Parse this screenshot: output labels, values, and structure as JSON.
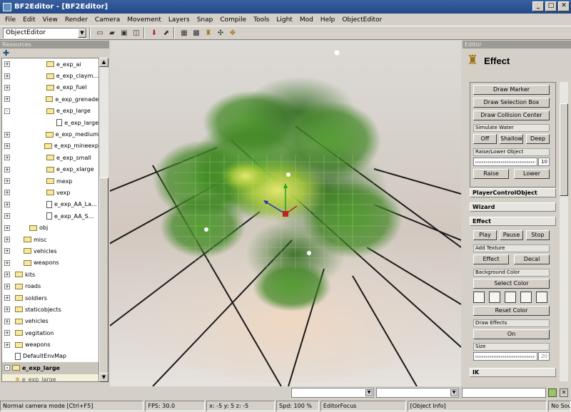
{
  "window": {
    "title": "BF2Editor - [BF2Editor]"
  },
  "menu": [
    "File",
    "Edit",
    "View",
    "Render",
    "Camera",
    "Movement",
    "Layers",
    "Snap",
    "Compile",
    "Tools",
    "Light",
    "Mod",
    "Help",
    "ObjectEditor"
  ],
  "toolbar": {
    "mode_combo": "ObjectEditor"
  },
  "resources": {
    "header": "Resources",
    "tree": [
      {
        "label": "e_exp_ai",
        "type": "folder",
        "indent": 62,
        "pm": "+"
      },
      {
        "label": "e_exp_claym...",
        "type": "folder",
        "indent": 62,
        "pm": "+"
      },
      {
        "label": "e_exp_fuel",
        "type": "folder",
        "indent": 62,
        "pm": "+"
      },
      {
        "label": "e_exp_grenade",
        "type": "folder",
        "indent": 62,
        "pm": "+"
      },
      {
        "label": "e_exp_large",
        "type": "folder",
        "indent": 62,
        "pm": "-"
      },
      {
        "label": "e_exp_large",
        "type": "file",
        "indent": 78,
        "pm": ""
      },
      {
        "label": "e_exp_medium",
        "type": "folder",
        "indent": 62,
        "pm": "+"
      },
      {
        "label": "e_exp_mineexp",
        "type": "folder",
        "indent": 62,
        "pm": "+"
      },
      {
        "label": "e_exp_small",
        "type": "folder",
        "indent": 62,
        "pm": "+"
      },
      {
        "label": "e_exp_xlarge",
        "type": "folder",
        "indent": 62,
        "pm": "+"
      },
      {
        "label": "mexp",
        "type": "folder",
        "indent": 62,
        "pm": "+"
      },
      {
        "label": "vexp",
        "type": "folder",
        "indent": 62,
        "pm": "+"
      },
      {
        "label": "e_exp_AA_La...",
        "type": "file",
        "indent": 62,
        "pm": "+"
      },
      {
        "label": "e_exp_AA_S...",
        "type": "file",
        "indent": 62,
        "pm": "+"
      },
      {
        "label": "obj",
        "type": "folder",
        "indent": 38,
        "pm": "+"
      },
      {
        "label": "misc",
        "type": "folder",
        "indent": 30,
        "pm": "+"
      },
      {
        "label": "vehicles",
        "type": "folder",
        "indent": 30,
        "pm": "+"
      },
      {
        "label": "weapons",
        "type": "folder",
        "indent": 30,
        "pm": "+"
      },
      {
        "label": "kits",
        "type": "folder",
        "indent": 18,
        "pm": "+"
      },
      {
        "label": "roads",
        "type": "folder",
        "indent": 18,
        "pm": "+"
      },
      {
        "label": "soldiers",
        "type": "folder",
        "indent": 18,
        "pm": "+"
      },
      {
        "label": "staticobjects",
        "type": "folder",
        "indent": 18,
        "pm": "+"
      },
      {
        "label": "vehicles",
        "type": "folder",
        "indent": 18,
        "pm": "+"
      },
      {
        "label": "vegitation",
        "type": "folder",
        "indent": 18,
        "pm": "+"
      },
      {
        "label": "weapons",
        "type": "folder",
        "indent": 18,
        "pm": "+"
      },
      {
        "label": "DefaultEnvMap",
        "type": "file",
        "indent": 18,
        "pm": ""
      },
      {
        "label": "e_exp_large",
        "type": "folder",
        "indent": 14,
        "pm": "-",
        "state": "selected-parent"
      },
      {
        "label": "e_exp_large",
        "type": "effect",
        "indent": 18,
        "pm": "",
        "state": "selected-child"
      }
    ]
  },
  "editor": {
    "header": "Editor",
    "title": "Effect",
    "draw_marker": "Draw Marker",
    "draw_selection_box": "Draw Selection Box",
    "draw_collision_center": "Draw Collision Center",
    "simulate_water_label": "Simulate Water",
    "water_off": "Off",
    "water_shallow": "Shallow",
    "water_deep": "Deep",
    "raise_lower_label": "Raise/Lower Object",
    "raise_lower_value": "10",
    "raise": "Raise",
    "lower": "Lower",
    "section_player": "PlayerControlObject",
    "section_wizard": "Wizard",
    "section_effect": "Effect",
    "play": "Play",
    "pause": "Pause",
    "stop": "Stop",
    "add_texture_label": "Add Texture",
    "add_effect": "Effect",
    "add_decal": "Decal",
    "background_color_label": "Background Color",
    "select_color": "Select Color",
    "reset_color": "Reset Color",
    "draw_effects_label": "Draw Effects",
    "draw_effects_value": "On",
    "size_label": "Size",
    "size_value": "20",
    "section_ik": "IK"
  },
  "status": {
    "mode": "Normal camera mode [Ctrl+F5]",
    "fps": "FPS: 30.0",
    "coords": "x: -5 y: 5 z: -5",
    "speed": "Spd: 100 %",
    "focus": "EditorFocus",
    "info": "[Object Info]",
    "source": "No Sou"
  },
  "colors": {
    "smoke_green": "#4a9a2a",
    "smoke_core": "#d8e060",
    "gizmo_x": "#c02020",
    "gizmo_y": "#20a020",
    "gizmo_z": "#2030c0"
  }
}
